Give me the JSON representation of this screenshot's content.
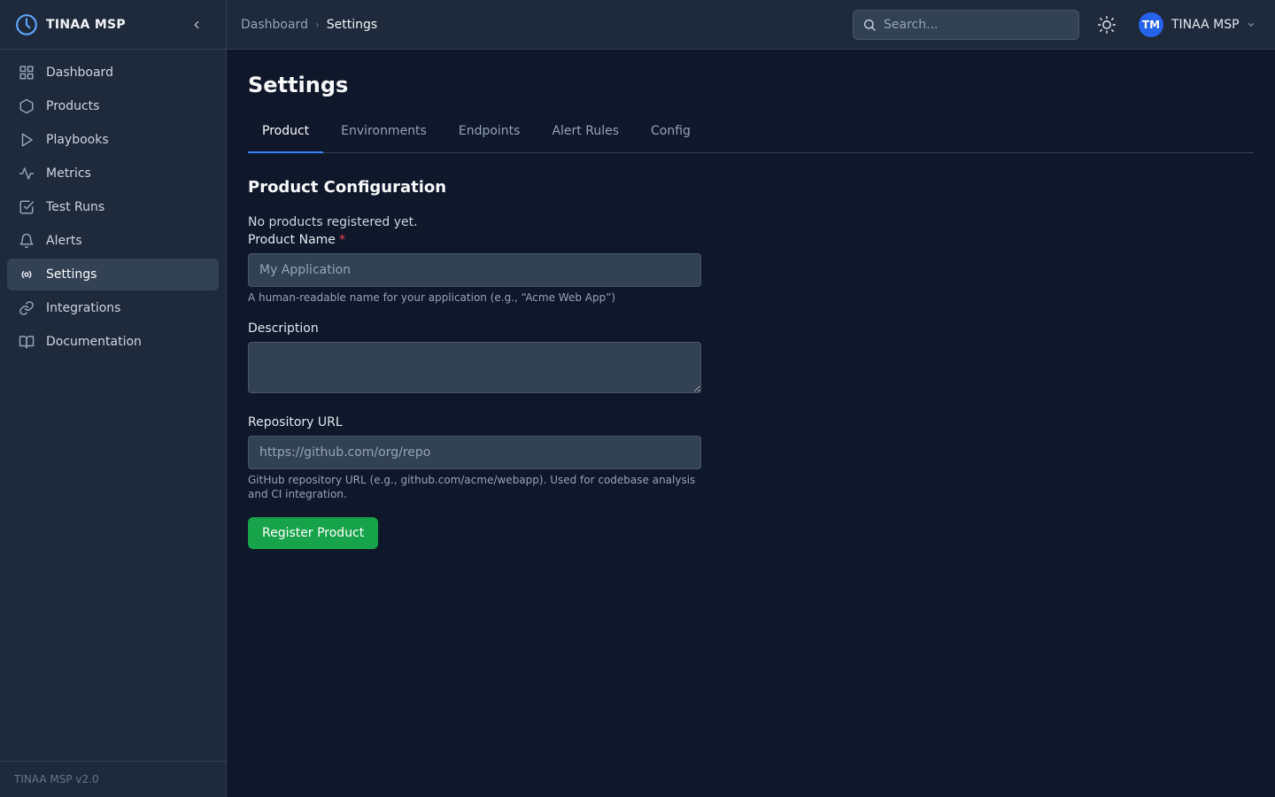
{
  "app": {
    "brand": "TINAA MSP",
    "version_label": "TINAA MSP v2.0"
  },
  "sidebar": {
    "items": [
      {
        "label": "Dashboard",
        "icon": "grid-icon"
      },
      {
        "label": "Products",
        "icon": "hexagon-icon"
      },
      {
        "label": "Playbooks",
        "icon": "play-icon"
      },
      {
        "label": "Metrics",
        "icon": "activity-icon"
      },
      {
        "label": "Test Runs",
        "icon": "check-square-icon"
      },
      {
        "label": "Alerts",
        "icon": "bell-icon"
      },
      {
        "label": "Settings",
        "icon": "radio-icon",
        "active": true
      },
      {
        "label": "Integrations",
        "icon": "link-icon"
      },
      {
        "label": "Documentation",
        "icon": "book-icon"
      }
    ]
  },
  "header": {
    "breadcrumb": {
      "parent": "Dashboard",
      "current": "Settings"
    },
    "search_placeholder": "Search...",
    "user": {
      "initials": "TM",
      "name": "TINAA MSP"
    }
  },
  "main": {
    "title": "Settings",
    "tabs": [
      {
        "label": "Product",
        "active": true
      },
      {
        "label": "Environments"
      },
      {
        "label": "Endpoints"
      },
      {
        "label": "Alert Rules"
      },
      {
        "label": "Config"
      }
    ],
    "section_title": "Product Configuration",
    "empty_message": "No products registered yet.",
    "form": {
      "product_name": {
        "label": "Product Name",
        "required_mark": "*",
        "placeholder": "My Application",
        "value": "",
        "help": "A human-readable name for your application (e.g., “Acme Web App”)"
      },
      "description": {
        "label": "Description",
        "value": ""
      },
      "repository_url": {
        "label": "Repository URL",
        "placeholder": "https://github.com/org/repo",
        "value": "",
        "help": "GitHub repository URL (e.g., github.com/acme/webapp). Used for codebase analysis and CI integration."
      },
      "submit_label": "Register Product"
    }
  },
  "colors": {
    "background": "#0f172a",
    "panel": "#1e293b",
    "accent": "#3b82f6",
    "primary_button": "#16a34a",
    "required": "#ef4444"
  }
}
